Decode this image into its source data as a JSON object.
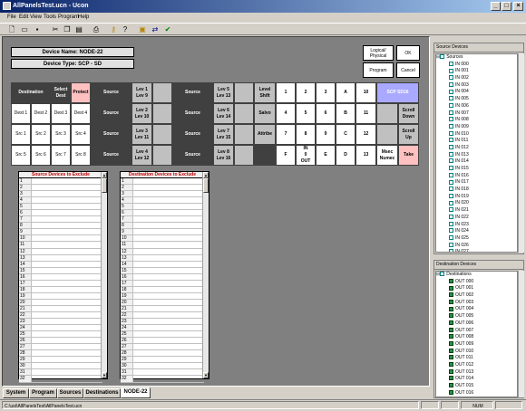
{
  "window": {
    "title": "AllPanelsTest.ucn - Ucon",
    "min": "_",
    "max": "□",
    "close": "×"
  },
  "menu": [
    "File",
    "Edit",
    "View",
    "Tools",
    "Program",
    "Help"
  ],
  "toolbar": {
    "icons": [
      "new-icon",
      "open-icon",
      "save-icon",
      "cut-icon",
      "copy-icon",
      "paste-icon",
      "print-icon",
      "key-icon",
      "help-icon",
      "panel-icon",
      "transfer-icon",
      "check-icon"
    ]
  },
  "panel": {
    "device_name": "Device Name: NODE-22",
    "device_type": "Device Type: SCP - SD",
    "logical_physical": "Logical/\nPhysical",
    "ok": "OK",
    "program": "Program",
    "cancel": "Cancel",
    "grid": [
      [
        "Destination",
        "Select\nDest",
        "Protect",
        "Source",
        "Lev 1\nLev 9",
        "",
        "Source",
        "Lev 5\nLev 13",
        "",
        "Level\nShift",
        "1",
        "2",
        "3",
        "A",
        "10",
        "SCP SD16"
      ],
      [
        "Dest 1",
        "Dest 2",
        "Dest 3",
        "Dest 4",
        "Source",
        "Lev 2\nLev 10",
        "",
        "Source",
        "Lev 6\nLev 14",
        "",
        "Salvo",
        "4",
        "5",
        "6",
        "B",
        "11",
        "",
        "Scroll\nDown"
      ],
      [
        "Src 1",
        "Src 2",
        "Src 3",
        "Src 4",
        "Source",
        "Lev 3\nLev 11",
        "",
        "Source",
        "Lev 7\nLev 15",
        "",
        "Attribe",
        "7",
        "8",
        "9",
        "C",
        "12",
        "",
        "Scroll\nUp"
      ],
      [
        "Src 5",
        "Src 6",
        "Src 7",
        "Src 8",
        "Source",
        "Lev 4\nLev 12",
        "",
        "Source",
        "Lev 8\nLev 16",
        "",
        "",
        "F",
        "IN\n0\nOUT",
        "E",
        "D",
        "13",
        "Msec\nNumec",
        "Take"
      ]
    ],
    "src_exclude_title": "Source Devices to Exclude",
    "dst_exclude_title": "Destination Devices to Exclude",
    "rows": [
      "1",
      "2",
      "3",
      "4",
      "5",
      "6",
      "7",
      "8",
      "9",
      "10",
      "11",
      "12",
      "13",
      "14",
      "15",
      "16",
      "17",
      "18",
      "19",
      "20",
      "21",
      "22",
      "23",
      "24",
      "25",
      "26",
      "27",
      "28",
      "29",
      "30",
      "31",
      "32"
    ]
  },
  "tabs": [
    "System",
    "Program",
    "Sources",
    "Destinations",
    "NODE-22"
  ],
  "status": {
    "path": "C:\\ust\\AllPanelsTest\\AllPanelsTest.ucn",
    "num": "NUM"
  },
  "source_pane": {
    "title": "Source Devices",
    "root": "Sources",
    "items": [
      "IN 000",
      "IN 001",
      "IN 002",
      "IN 003",
      "IN 004",
      "IN 005",
      "IN 006",
      "IN 007",
      "IN 008",
      "IN 009",
      "IN 010",
      "IN 011",
      "IN 012",
      "IN 013",
      "IN 014",
      "IN 015",
      "IN 016",
      "IN 017",
      "IN 018",
      "IN 019",
      "IN 020",
      "IN 021",
      "IN 022",
      "IN 023",
      "IN 024",
      "IN 025",
      "IN 026",
      "IN 027",
      "IN 028"
    ]
  },
  "dest_pane": {
    "title": "Destination Devices",
    "root": "Destinations",
    "items": [
      "OUT 000",
      "OUT 001",
      "OUT 002",
      "OUT 003",
      "OUT 004",
      "OUT 005",
      "OUT 006",
      "OUT 007",
      "OUT 008",
      "OUT 009",
      "OUT 010",
      "OUT 011",
      "OUT 012",
      "OUT 013",
      "OUT 014",
      "OUT 015",
      "OUT 016",
      "OUT 017",
      "OUT 018"
    ]
  }
}
